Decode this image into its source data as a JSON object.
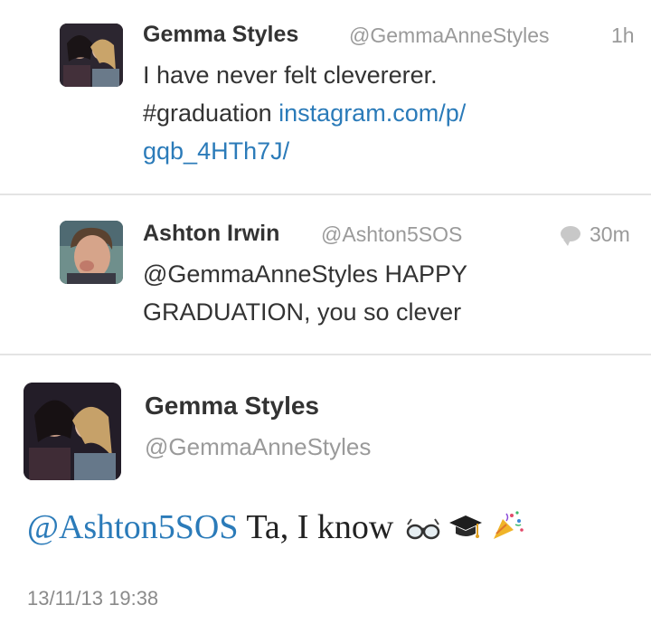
{
  "tweet1": {
    "name": "Gemma Styles",
    "handle": "@GemmaAnneStyles",
    "time": "1h",
    "line1": "I have never felt clevererer.",
    "hashtag": "#graduation",
    "link_part1": "instagram.com/p/",
    "link_part2": "gqb_4HTh7J/"
  },
  "tweet2": {
    "name": "Ashton Irwin",
    "handle": "@Ashton5SOS",
    "time": "30m",
    "line1": "@GemmaAnneStyles HAPPY",
    "line2": "GRADUATION, you so clever"
  },
  "tweet3": {
    "name": "Gemma Styles",
    "handle": "@GemmaAnneStyles",
    "mention": "@Ashton5SOS",
    "text": "Ta, I know",
    "timestamp": "13/11/13 19:38"
  },
  "emoji_icons": [
    "glasses-icon",
    "graduation-cap-icon",
    "party-popper-icon"
  ],
  "colors": {
    "link": "#2b7bb9",
    "meta": "#9a9a9a",
    "divider": "#e4e4e4"
  }
}
